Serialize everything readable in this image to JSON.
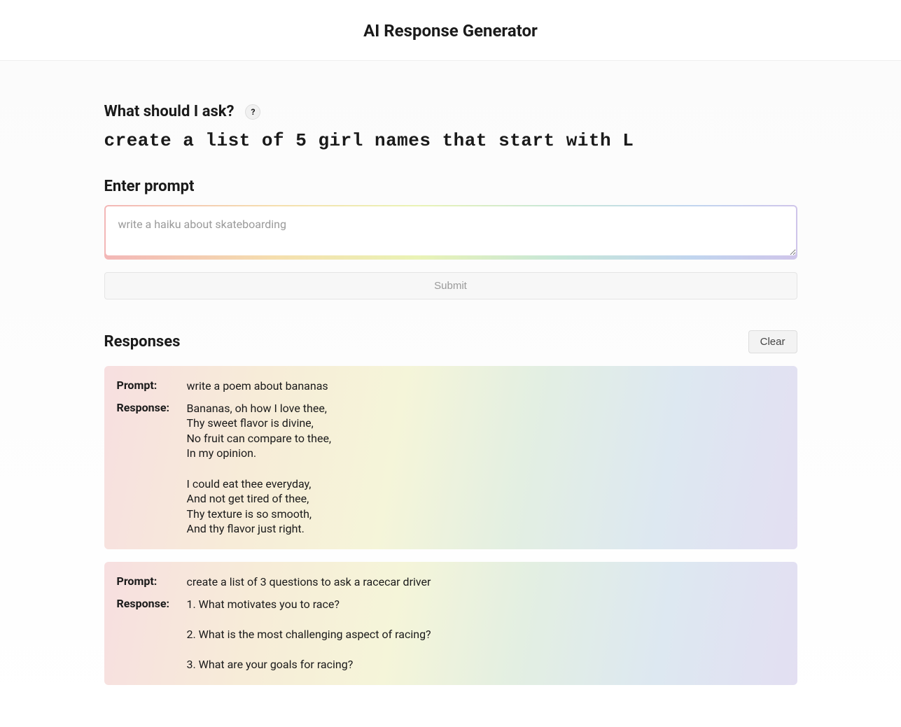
{
  "header": {
    "title": "AI Response Generator"
  },
  "suggestion": {
    "label": "What should I ask?",
    "help_icon": "?",
    "text": "create a list of 5 girl names that start with L"
  },
  "prompt": {
    "label": "Enter prompt",
    "placeholder": "write a haiku about skateboarding",
    "submit_label": "Submit"
  },
  "responses_section": {
    "label": "Responses",
    "clear_label": "Clear"
  },
  "field_labels": {
    "prompt": "Prompt:",
    "response": "Response:"
  },
  "responses": [
    {
      "prompt": "write a poem about bananas",
      "response": "Bananas, oh how I love thee,\nThy sweet flavor is divine,\nNo fruit can compare to thee,\nIn my opinion.\n\nI could eat thee everyday,\nAnd not get tired of thee,\nThy texture is so smooth,\nAnd thy flavor just right."
    },
    {
      "prompt": "create a list of 3 questions to ask a racecar driver",
      "response": "1. What motivates you to race?\n\n2. What is the most challenging aspect of racing?\n\n3. What are your goals for racing?"
    }
  ]
}
